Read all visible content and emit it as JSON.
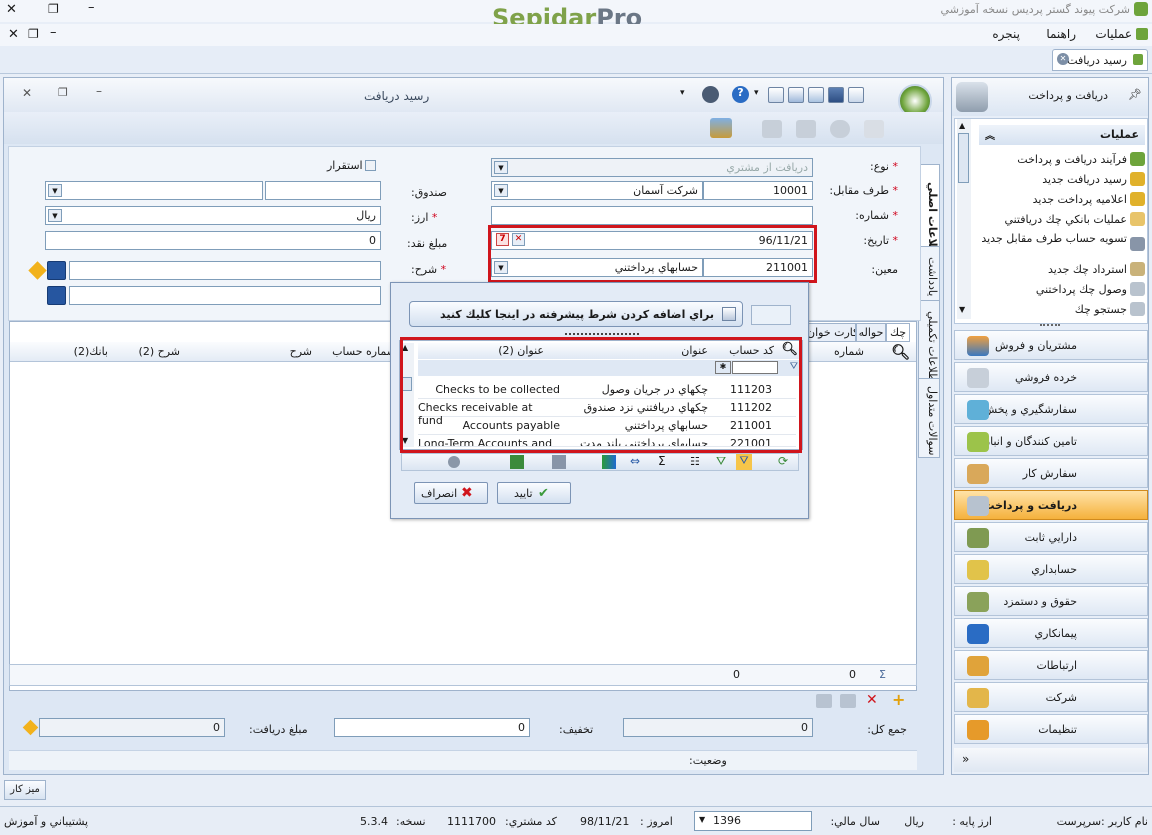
{
  "app": {
    "title": "شركت پيوند گستر پرديس نسخه آموزشي",
    "logo_main": "Sepidar",
    "logo_pro": "Pro"
  },
  "menu": {
    "items": [
      "عمليات",
      "راهنما",
      "پنجره"
    ]
  },
  "doc_tab": "رسيد دريافت",
  "form": {
    "title": "رسيد دريافت",
    "vtabs": [
      "اطلاعات اصلي",
      "يادداشت",
      "اطلاعات تكميلي",
      "سوالات متداول"
    ],
    "type": {
      "label": "نوع:",
      "value": "دريافت از مشتري"
    },
    "party": {
      "label": "طرف مقابل:",
      "code": "10001",
      "name": "شركت آسمان"
    },
    "number": {
      "label": "شماره:",
      "value": ""
    },
    "date": {
      "label": "تاريخ:",
      "value": "96/11/21"
    },
    "account": {
      "label": "معين:",
      "code": "211001",
      "name": "حسابهاي پرداختني"
    },
    "stable": {
      "label": "استقرار"
    },
    "fund": {
      "label": "صندوق:"
    },
    "currency": {
      "label": "ارز:",
      "value": "ريال"
    },
    "cash": {
      "label": "مبلغ نقد:",
      "value": "0"
    },
    "desc": {
      "label": "شرح:"
    },
    "tabs": [
      "چك",
      "حواله",
      "كارت خوان"
    ],
    "grid_headers": {
      "num": "شماره",
      "account_num": "شماره حساب",
      "desc": "شرح",
      "desc2": "شرح (2)",
      "bank2": "بانك(2)"
    },
    "sum_value": "0",
    "sum_value2": "0",
    "total": {
      "label": "جمع كل:",
      "value": "0"
    },
    "discount": {
      "label": "تخفيف:",
      "value": "0"
    },
    "received": {
      "label": "مبلغ دريافت:",
      "value": "0"
    },
    "status_label": "وضعيت:"
  },
  "popup": {
    "filter_button": "براي اضافه كردن شرط پيشرفته در اينجا كليك كنيد",
    "cols": {
      "code": "كد حساب",
      "title": "عنوان",
      "title2": "عنوان (2)"
    },
    "rows": [
      {
        "code": "111203",
        "title": "چكهاي در جريان وصول",
        "title2": "Checks to be collected"
      },
      {
        "code": "111202",
        "title": "چكهاي دريافتني نزد صندوق",
        "title2": "Checks receivable at fund"
      },
      {
        "code": "211001",
        "title": "حسابهاي پرداختني",
        "title2": "Accounts payable"
      },
      {
        "code": "221001",
        "title": "حسابهاي پرداختني بلند مدت",
        "title2": "Long-Term Accounts and ..."
      }
    ],
    "ok": "تاييد",
    "cancel": "انصراف"
  },
  "sidebar": {
    "header": "دريافت و پرداخت",
    "ops_title": "عمليات",
    "ops": [
      "فرآيند دريافت و پرداخت",
      "رسيد دريافت جديد",
      "اعلاميه پرداخت جديد",
      "عمليات بانكي چك دريافتني",
      "تسويه حساب طرف مقابل جديد",
      "استرداد چك جديد",
      "وصول چك پرداختني",
      "جستجو چك"
    ],
    "nav": [
      "مشتريان و فروش",
      "خرده فروشي",
      "سفارشگيري و پخش",
      "تامين كنندگان و انبار",
      "سفارش كار",
      "دريافت و پرداخت",
      "دارايي ثابت",
      "حسابداري",
      "حقوق و دستمزد",
      "پيمانكاري",
      "ارتباطات",
      "شركت",
      "تنظيمات"
    ]
  },
  "desk": "ميز كار",
  "statusbar": {
    "user": "نام كاربر :سرپرست",
    "base_currency": "ارز پايه :",
    "currency": "ريال",
    "fiscal_year": "سال مالي:",
    "year": "1396",
    "today": "امروز :",
    "date": "98/11/21",
    "customer_code": "كد مشتري:",
    "customer_value": "1111700",
    "version_label": "نسخه:",
    "version": "5.3.4",
    "support": "پشتيباني و آموزش"
  },
  "colors": {
    "accent": "#f5b13c",
    "highlight": "#d0151c",
    "header": "#e6edf7"
  }
}
